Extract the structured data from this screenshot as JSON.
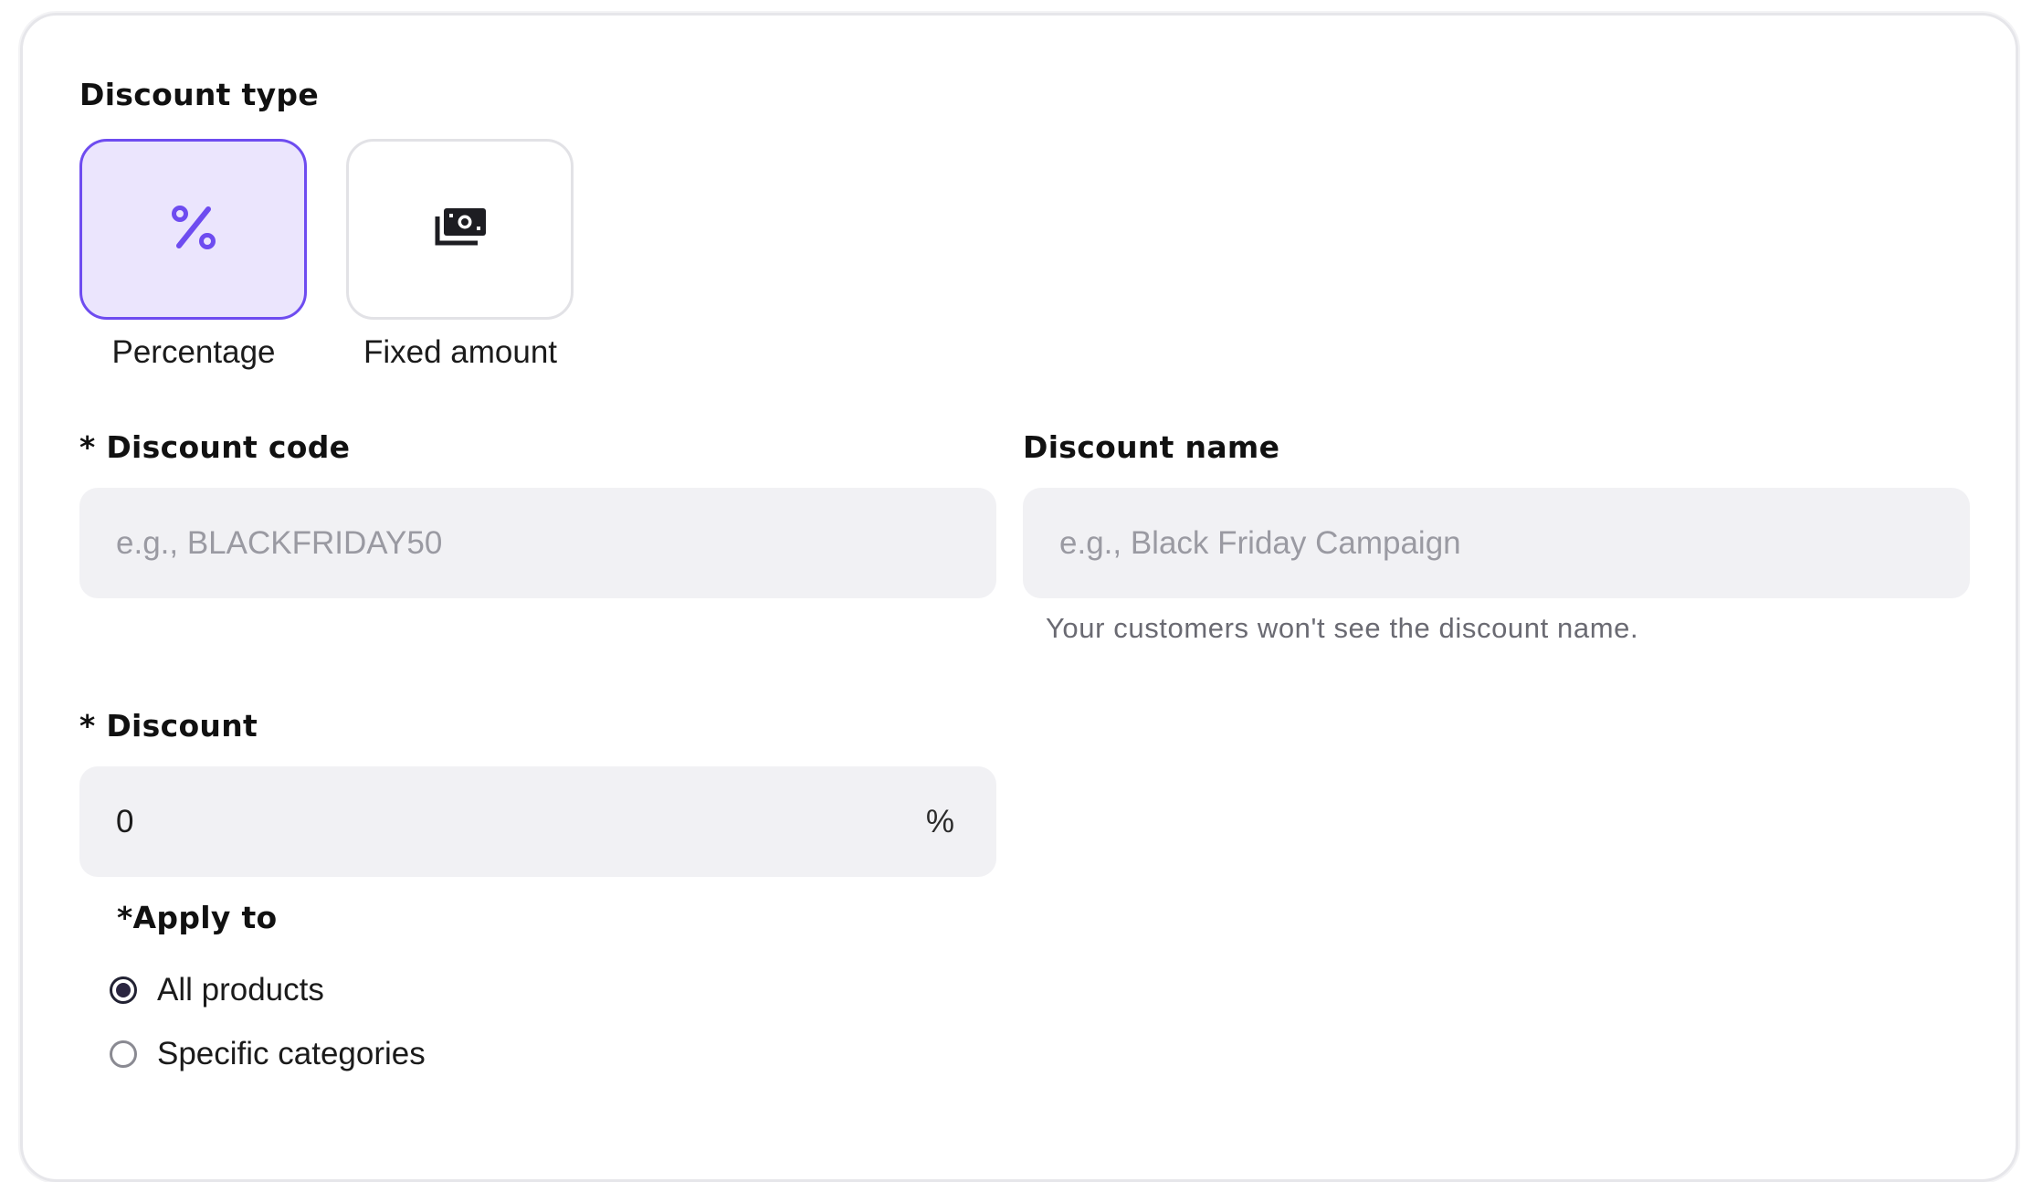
{
  "discount_type": {
    "label": "Discount type",
    "options": [
      {
        "label": "Percentage",
        "icon": "percent-icon",
        "selected": true
      },
      {
        "label": "Fixed amount",
        "icon": "cash-icon",
        "selected": false
      }
    ]
  },
  "discount_code": {
    "label": "* Discount code",
    "value": "",
    "placeholder": "e.g., BLACKFRIDAY50"
  },
  "discount_name": {
    "label": "Discount name",
    "value": "",
    "placeholder": "e.g., Black Friday Campaign",
    "helper": "Your customers won't see the discount name."
  },
  "discount": {
    "label": "* Discount",
    "value": "0",
    "suffix": "%"
  },
  "apply_to": {
    "label": "*Apply to",
    "options": [
      {
        "label": "All products",
        "checked": true
      },
      {
        "label": "Specific categories",
        "checked": false
      }
    ]
  },
  "colors": {
    "accent": "#6e4cf0",
    "accent_bg": "#ebe5fd",
    "input_bg": "#f1f1f4"
  }
}
